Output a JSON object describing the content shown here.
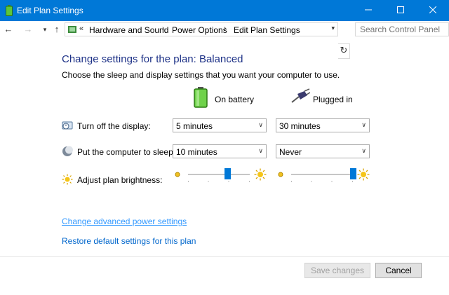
{
  "window": {
    "title": "Edit Plan Settings"
  },
  "address": {
    "overflow": "«",
    "crumbs": [
      "Hardware and Sound",
      "Power Options",
      "Edit Plan Settings"
    ],
    "search_placeholder": "Search Control Panel"
  },
  "content": {
    "heading": "Change settings for the plan: Balanced",
    "description": "Choose the sleep and display settings that you want your computer to use.",
    "columns": {
      "battery": "On battery",
      "plugged": "Plugged in"
    },
    "rows": {
      "display": {
        "label": "Turn off the display:",
        "battery": "5 minutes",
        "plugged": "30 minutes"
      },
      "sleep": {
        "label": "Put the computer to sleep:",
        "battery": "10 minutes",
        "plugged": "Never"
      },
      "brightness": {
        "label": "Adjust plan brightness:",
        "battery_level": 0.64,
        "plugged_level": 1.0
      }
    },
    "links": {
      "advanced": "Change advanced power settings",
      "restore": "Restore default settings for this plan"
    }
  },
  "footer": {
    "save": "Save changes",
    "cancel": "Cancel"
  },
  "colors": {
    "titlebar": "#0078d7",
    "heading": "#1e3287",
    "link": "#0066cc",
    "slider_thumb": "#0078d7"
  }
}
